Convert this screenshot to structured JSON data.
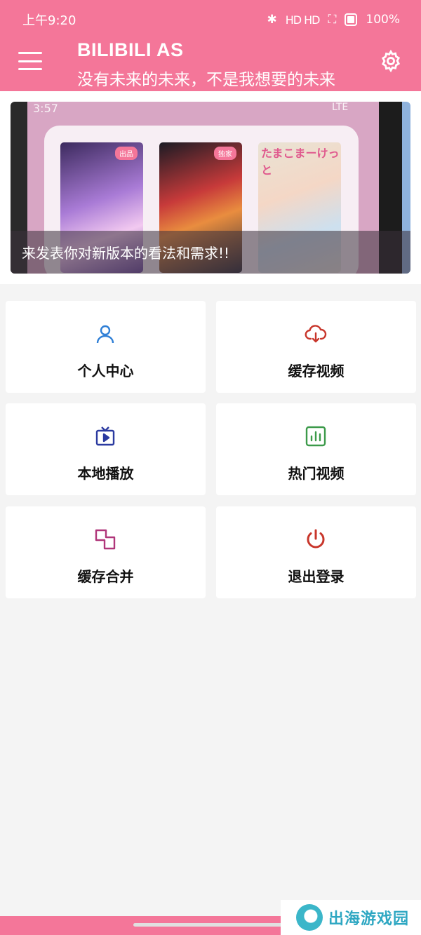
{
  "status_bar": {
    "time": "上午9:20",
    "indicators": "HD HD",
    "battery": "100%"
  },
  "header": {
    "title": "BILIBILI AS",
    "subtitle": "没有未来的未来，不是我想要的未来",
    "menu_icon": "hamburger-menu-icon",
    "settings_icon": "gear-icon",
    "background_color": "#f47699"
  },
  "banner": {
    "caption": "来发表你对新版本的看法和需求!!",
    "inner_status_time": "3:57",
    "inner_status_right": "LTE",
    "posters": [
      {
        "badge": "出品"
      },
      {
        "badge": "独家"
      },
      {
        "text": "たまこまーけっと"
      }
    ]
  },
  "tiles": [
    {
      "label": "个人中心",
      "icon": "user-icon",
      "color": "#2f7fd6"
    },
    {
      "label": "缓存视频",
      "icon": "cloud-download-icon",
      "color": "#c8362b"
    },
    {
      "label": "本地播放",
      "icon": "tv-play-icon",
      "color": "#2b3aa0"
    },
    {
      "label": "热门视频",
      "icon": "bar-chart-icon",
      "color": "#3c9a4a"
    },
    {
      "label": "缓存合并",
      "icon": "merge-squares-icon",
      "color": "#b0367a"
    },
    {
      "label": "退出登录",
      "icon": "power-icon",
      "color": "#c8362b"
    }
  ],
  "watermark": {
    "text": "出海游戏园"
  }
}
